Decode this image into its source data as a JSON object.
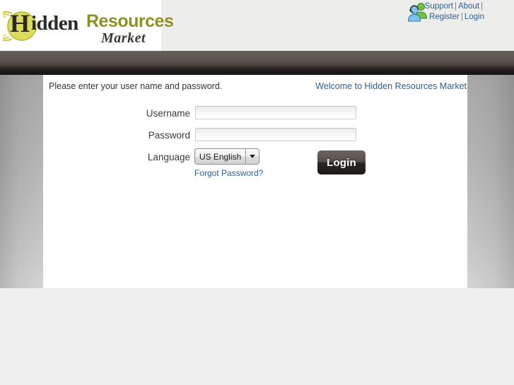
{
  "header": {
    "logo": {
      "swoosh_icon": "arc-swoosh-icon",
      "letter": "H",
      "word_hidden": "idden",
      "word_resources": "Resources",
      "word_market": "Market",
      "gold_color": "#8d9121",
      "dark_color": "#2b2a26"
    },
    "people_icon": "people-contacts-icon",
    "nav_row_1": [
      {
        "label": "Support"
      },
      {
        "label": "About"
      }
    ],
    "nav_row_2": [
      {
        "label": "Register"
      },
      {
        "label": "Login"
      }
    ],
    "separator": "|",
    "link_color": "#2f5f98"
  },
  "panel": {
    "intro_text": "Please enter your user name and password.",
    "welcome_text": "Welcome to Hidden Resources Market"
  },
  "form": {
    "username": {
      "label": "Username",
      "value": "",
      "placeholder": ""
    },
    "password": {
      "label": "Password",
      "value": "",
      "placeholder": ""
    },
    "language": {
      "label": "Language",
      "selected": "US English",
      "options": [
        "US English"
      ],
      "arrow_icon": "chevron-down-icon"
    },
    "forgot_password_label": "Forgot Password?",
    "login_button_label": "Login"
  },
  "colors": {
    "dark_bar_top": "#655d57",
    "dark_bar_bottom": "#191715",
    "page_bottom": "#efefef",
    "link": "#2f5f98"
  }
}
